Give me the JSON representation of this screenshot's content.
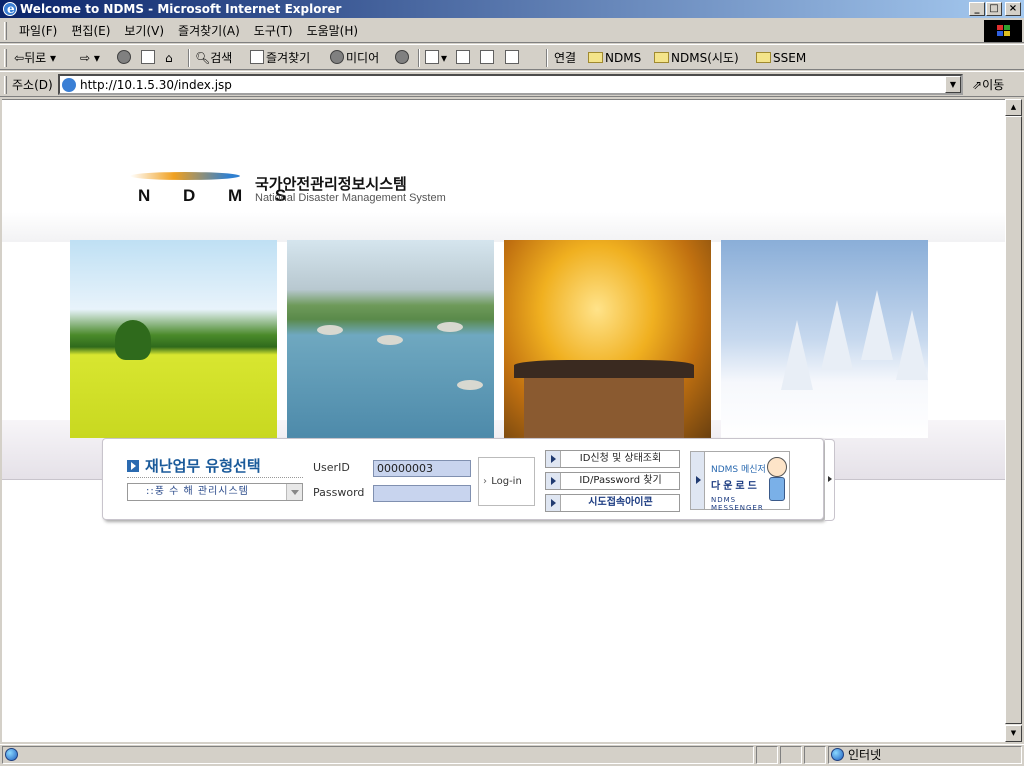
{
  "window": {
    "title": "Welcome to NDMS - Microsoft Internet Explorer"
  },
  "menubar": {
    "items": [
      "파일(F)",
      "편집(E)",
      "보기(V)",
      "즐겨찾기(A)",
      "도구(T)",
      "도움말(H)"
    ]
  },
  "toolbar": {
    "back_label": "뒤로",
    "search_label": "검색",
    "favorites_label": "즐겨찾기",
    "media_label": "미디어",
    "links_label": "연결",
    "link_items": [
      "NDMS",
      "NDMS(시도)",
      "SSEM"
    ]
  },
  "addressbar": {
    "label": "주소(D)",
    "url": "http://10.1.5.30/index.jsp",
    "go_label": "이동"
  },
  "page": {
    "logo_text": "N D M S",
    "title_korean": "국가안전관리정보시스템",
    "title_english": "National Disaster Management System",
    "login": {
      "section_title": "재난업무 유형선택",
      "system_select_value": "::풍 수 해  관리시스템",
      "userid_label": "UserID",
      "userid_value": "00000003",
      "password_label": "Password",
      "login_button": "Log-in",
      "links": [
        "ID신청 및 상태조회",
        "ID/Password 찾기",
        "시도접속아이콘"
      ],
      "messenger_line1": "NDMS 메신저",
      "messenger_line2": "다운로드",
      "messenger_line3": "NDMS MESSENGER"
    }
  },
  "statusbar": {
    "zone_label": "인터넷"
  }
}
